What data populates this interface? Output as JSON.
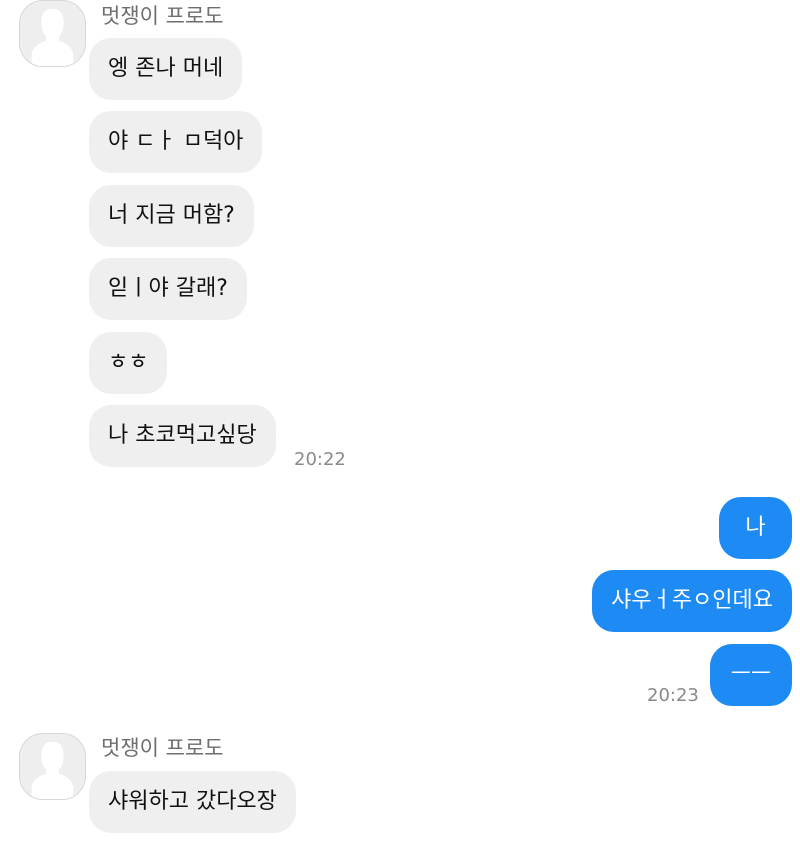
{
  "colors": {
    "incoming_bubble": "#efefef",
    "outgoing_bubble": "#1d8bf3",
    "timestamp": "#8a8a8a"
  },
  "group1": {
    "sender": "멋쟁이 프로도",
    "avatar_icon": "default-profile-icon",
    "messages": [
      "엥 존나 머네",
      "야 ㄷㅏ ㅁ덕아",
      "너 지금 머함?",
      "읻ㅣ야 갈래?",
      "ㅎㅎ",
      "나 초코먹고싶당"
    ],
    "time": "20:22"
  },
  "group2": {
    "messages": [
      "나",
      "샤우ㅓ주ㅇ인데요",
      "ㅡㅡ"
    ],
    "time": "20:23"
  },
  "group3": {
    "sender": "멋쟁이 프로도",
    "avatar_icon": "default-profile-icon",
    "messages": [
      "샤워하고 갔다오장"
    ]
  }
}
